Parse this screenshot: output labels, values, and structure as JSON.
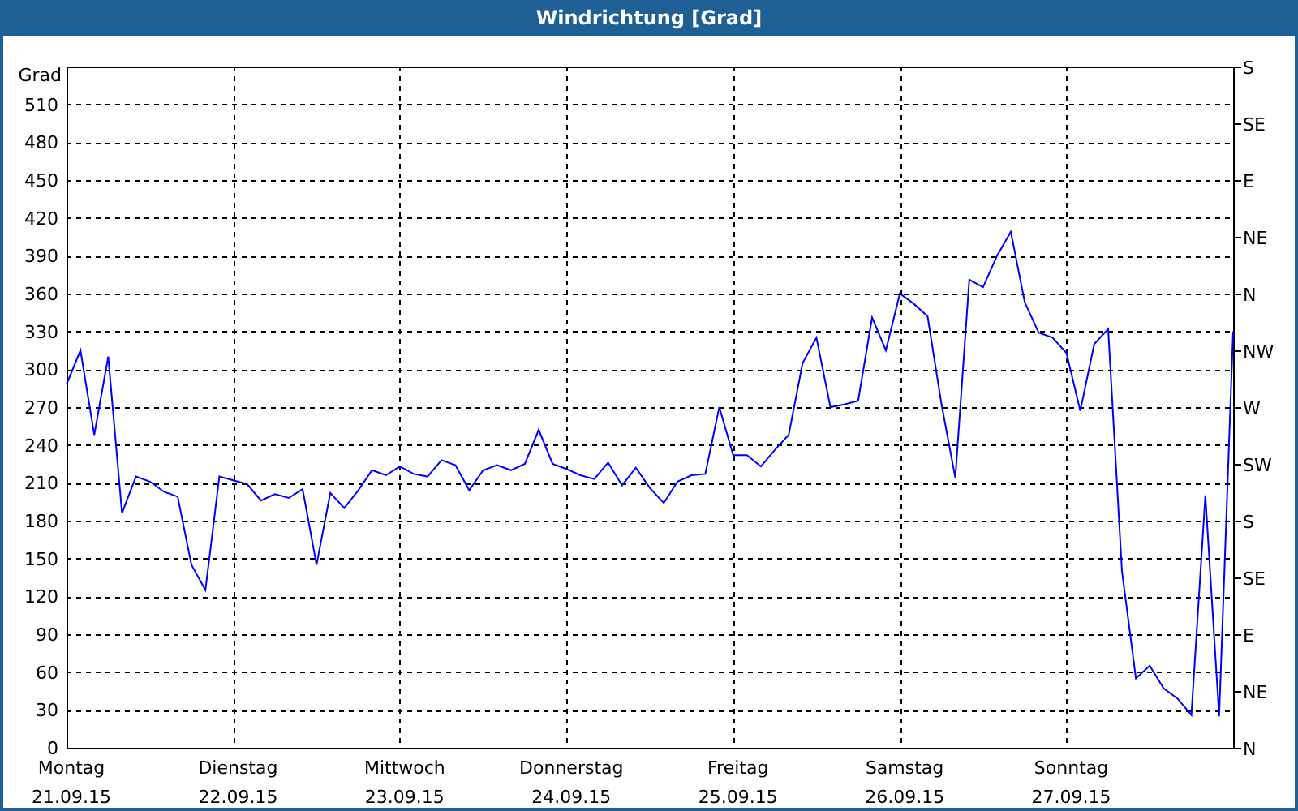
{
  "window": {
    "title": "Windrichtung [Grad]"
  },
  "chart": {
    "chart_data": {
      "type": "line",
      "grid": true,
      "ylabel": "Grad",
      "ylim": [
        0,
        540
      ],
      "yticks": [
        0,
        30,
        60,
        90,
        120,
        150,
        180,
        210,
        240,
        270,
        300,
        330,
        360,
        390,
        420,
        450,
        480,
        510
      ],
      "categories": [
        "Montag\n21.09.15",
        null,
        null,
        null,
        null,
        null,
        null,
        null,
        null,
        null,
        null,
        null,
        "Dienstag\n22.09.15",
        null,
        null,
        null,
        null,
        null,
        null,
        null,
        null,
        null,
        null,
        null,
        "Mittwoch\n23.09.15",
        null,
        null,
        null,
        null,
        null,
        null,
        null,
        null,
        null,
        null,
        null,
        "Donnerstag\n24.09.15",
        null,
        null,
        null,
        null,
        null,
        null,
        null,
        null,
        null,
        null,
        null,
        "Freitag\n25.09.15",
        null,
        null,
        null,
        null,
        null,
        null,
        null,
        null,
        null,
        null,
        null,
        "Samstag\n26.09.15",
        null,
        null,
        null,
        null,
        null,
        null,
        null,
        null,
        null,
        null,
        null,
        "Sonntag\n27.09.15",
        null,
        null,
        null,
        null,
        null,
        null,
        null,
        null,
        null,
        null,
        null,
        null
      ],
      "series": [
        {
          "color": "#0000ff",
          "values": [
            288,
            315,
            248,
            310,
            186,
            215,
            211,
            203,
            199,
            145,
            125,
            215,
            212,
            209,
            196,
            201,
            198,
            205,
            145,
            202,
            190,
            204,
            220,
            216,
            223,
            217,
            215,
            228,
            224,
            204,
            220,
            224,
            220,
            225,
            252,
            225,
            221,
            216,
            213,
            226,
            208,
            222,
            206,
            194,
            211,
            216,
            217,
            270,
            232,
            232,
            223,
            236,
            248,
            305,
            325,
            270,
            272,
            275,
            341,
            315,
            360,
            352,
            342,
            272,
            214,
            371,
            365,
            390,
            409,
            353,
            329,
            325,
            313,
            267,
            320,
            332,
            140,
            55,
            65,
            47,
            39,
            26,
            200,
            25,
            330
          ]
        }
      ]
    },
    "compass_scale": [
      "S",
      "SE",
      "E",
      "NE",
      "N",
      "NW",
      "W",
      "SW",
      "S",
      "SE",
      "E",
      "NE",
      "N"
    ]
  }
}
